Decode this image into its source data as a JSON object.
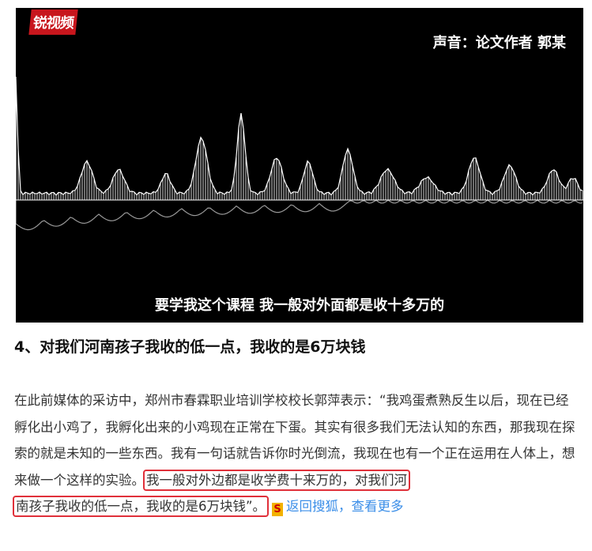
{
  "video": {
    "logo": "锐视频",
    "credit": "声音：论文作者 郭某",
    "subtitle": "要学我这个课程 我一般对外面都是收十多万的"
  },
  "article": {
    "heading": "4、对我们河南孩子我收的低一点，我收的是6万块钱",
    "paragraph_start": "在此前媒体的采访中，郑州市春霖职业培训学校校长郭萍表示：“我鸡蛋煮熟反生以后，现在已经孵化出小鸡了，我孵化出来的小鸡现在正常在下蛋。其实有很多我们无法认知的东西，那我现在探索的就是未知的一些东西。我有一句话就告诉你时光倒流，我现在也有一个正在运用在人体上，想来做一个这样的实验。",
    "highlight_1": "我一般对外边都是收学费十来万的，对我们河",
    "highlight_2": "南孩子我收的低一点，我收的是6万块钱”。",
    "source_icon": "sohu-icon",
    "more_link": "返回搜狐，查看更多"
  },
  "colors": {
    "highlight_border": "#e0303a",
    "link": "#3b8ee8",
    "logo_bg": "#c8161d"
  }
}
